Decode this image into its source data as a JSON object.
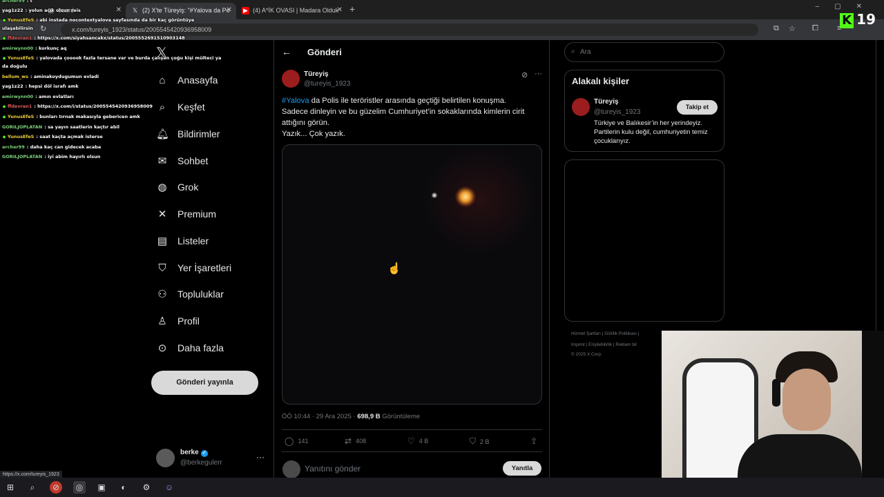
{
  "browser": {
    "tabs": [
      {
        "label": "board",
        "active": false
      },
      {
        "label": "(2) X'te Türeyiş: \"#Yalova da Po",
        "active": true
      },
      {
        "label": "(4) A*İK OVASI | Madara Olduk",
        "active": false
      }
    ],
    "new_tab": "+",
    "url": "x.com/tureyis_1923/status/2005545420936958009",
    "status_url": "https://x.com/tureyis_1923"
  },
  "overlay": {
    "kick_count": "19",
    "kick_logo": "K"
  },
  "chat": [
    {
      "user": "archer99",
      "msg": ": t",
      "color": "#7fd37f",
      "badge": ""
    },
    {
      "user": "yag1z22",
      "msg": ": yolun acık olsun reis",
      "color": "#ffffff",
      "badge": ""
    },
    {
      "user": "YunusEfeS",
      "msg": ": abi instada nocontextyalova sayfasında da bir kaç görüntüye",
      "color": "#f0d23c",
      "badge": "◆"
    },
    {
      "user": "",
      "msg": "ulaşabilirsin",
      "color": "#ffffff",
      "badge": ""
    },
    {
      "user": "ffdevran1",
      "msg": ": https://x.com/siyahsancakx/status/2005552691510903148",
      "color": "#e05a5a",
      "badge": "◆"
    },
    {
      "user": "emirwynn00",
      "msg": ": korkunç aq",
      "color": "#7fd37f",
      "badge": ""
    },
    {
      "user": "YunusEfeS",
      "msg": ": yalovada çooook fazla tersane var ve burda çalışan çoğu kişi mülteci ya",
      "color": "#f0d23c",
      "badge": "◆"
    },
    {
      "user": "",
      "msg": "da doğulu",
      "color": "#ffffff",
      "badge": ""
    },
    {
      "user": "bellum_ws",
      "msg": ": aminakoydugumun evladi",
      "color": "#f0d23c",
      "badge": ""
    },
    {
      "user": "yag1z22",
      "msg": ": hepsi döl israfı amk",
      "color": "#ffffff",
      "badge": ""
    },
    {
      "user": "emirwynn00",
      "msg": ": amın evlatları",
      "color": "#7fd37f",
      "badge": ""
    },
    {
      "user": "ffdevran1",
      "msg": ": https://x.com/i/status/2005545420936958009",
      "color": "#e05a5a",
      "badge": "◆"
    },
    {
      "user": "YunusEfeS",
      "msg": ": bunları tırnak makasıyla gebericen amk",
      "color": "#f0d23c",
      "badge": "◆"
    },
    {
      "user": "GORILJOPLATAN",
      "msg": ": sa yayın saatlerin kaçtır abil",
      "color": "#7fd37f",
      "badge": ""
    },
    {
      "user": "YunusEfeS",
      "msg": ": saat kaçta açmak isterse",
      "color": "#f0d23c",
      "badge": "◆"
    },
    {
      "user": "archer99",
      "msg": ": daha kaç can gidecek acaba",
      "color": "#7fd37f",
      "badge": ""
    },
    {
      "user": "GORILJOPLATAN",
      "msg": ": iyi abim hayırlı olsun",
      "color": "#7fd37f",
      "badge": ""
    }
  ],
  "nav": {
    "items": [
      {
        "label": "Anasayfa",
        "icon": "home-icon",
        "glyph": "⌂"
      },
      {
        "label": "Keşfet",
        "icon": "search-icon",
        "glyph": "⌕"
      },
      {
        "label": "Bildirimler",
        "icon": "bell-icon",
        "glyph": "♫"
      },
      {
        "label": "Sohbet",
        "icon": "mail-icon",
        "glyph": "✉"
      },
      {
        "label": "Grok",
        "icon": "grok-icon",
        "glyph": "◍"
      },
      {
        "label": "Premium",
        "icon": "x-icon",
        "glyph": "✕"
      },
      {
        "label": "Listeler",
        "icon": "list-icon",
        "glyph": "▤"
      },
      {
        "label": "Yer İşaretleri",
        "icon": "bookmark-icon",
        "glyph": "⛉"
      },
      {
        "label": "Topluluklar",
        "icon": "communities-icon",
        "glyph": "⚇"
      },
      {
        "label": "Profil",
        "icon": "profile-icon",
        "glyph": "♙"
      },
      {
        "label": "Daha fazla",
        "icon": "more-icon",
        "glyph": "⊙"
      }
    ],
    "post_button": "Gönderi yayınla",
    "user": {
      "name": "berke",
      "handle": "@berkegulerr",
      "more": "···"
    }
  },
  "post": {
    "header": "Gönderi",
    "author": "Türeyiş",
    "handle": "@tureyis_1923",
    "hashtag": "#Yalova",
    "text_1": " da Polis ile teröristler arasında geçtiği belirtilen konuşma.",
    "text_2": "Sadece dinleyin ve bu güzelim Cumhuriyet’in sokaklarında kimlerin cirit attığını görün.",
    "text_3": "Yazık... Çok yazık.",
    "time": "ÖÖ 10:44 · 29 Ara 2025 · ",
    "views_count": "698,9 B",
    "views_label": " Görüntüleme",
    "replies": "141",
    "reposts": "408",
    "likes": "4 B",
    "bookmarks": "2 B",
    "reply_placeholder": "Yanıtını gönder",
    "reply_button": "Yanıtla"
  },
  "sidebar": {
    "search_placeholder": "Ara",
    "related_title": "Alakalı kişiler",
    "related_name": "Türeyiş",
    "related_handle": "@tureyis_1923",
    "follow_button": "Takip et",
    "related_bio": "Türkiye ve Balıkesir’in her yerindeyiz. Partilerin kulu değil, cumhuriyetin temiz çocuklarıyız.",
    "footer_1": "Hizmet Şartları  |  Gizlilik Politikası  |",
    "footer_2": "Imprint  |  Erişilebilirlik  |  Reklam bil",
    "footer_3": "© 2025 X Corp."
  },
  "colors": {
    "accent": "#1d9bf0",
    "kick_green": "#53fc18",
    "background": "#000000"
  }
}
